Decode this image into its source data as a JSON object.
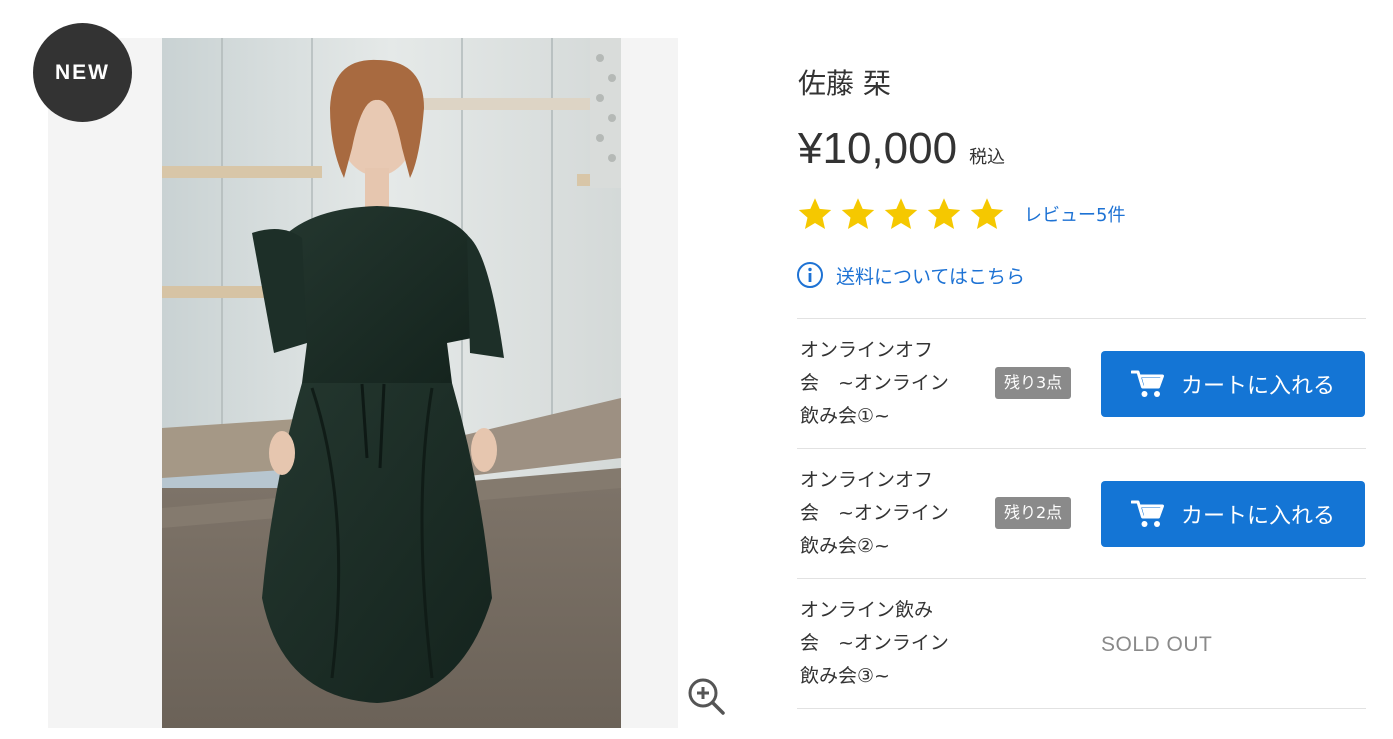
{
  "badge": {
    "label": "NEW"
  },
  "product": {
    "title": "佐藤 栞",
    "price": "¥10,000",
    "tax_label": "税込",
    "rating": 5,
    "rating_max": 5,
    "review_label": "レビュー5件",
    "shipping_label": "送料についてはこちら"
  },
  "icons": {
    "badge": "new-badge",
    "zoom": "zoom-in-icon",
    "info": "info-circle-icon",
    "cart": "shopping-cart-icon",
    "star": "star-icon"
  },
  "colors": {
    "accent_blue": "#1475d5",
    "link_blue": "#1d72d4",
    "star_yellow": "#f5c800",
    "badge_dark": "#333333",
    "stock_gray": "#8a8a8a"
  },
  "variants": [
    {
      "name": "オンラインオフ\n会　~オンライン\n飲み会①~",
      "stock": "残り3点",
      "button_label": "カートに入れる",
      "soldout_label": ""
    },
    {
      "name": "オンラインオフ\n会　~オンライン\n飲み会②~",
      "stock": "残り2点",
      "button_label": "カートに入れる",
      "soldout_label": ""
    },
    {
      "name": "オンライン飲み\n会　~オンライン\n飲み会③~",
      "stock": "",
      "button_label": "",
      "soldout_label": "SOLD OUT"
    }
  ]
}
